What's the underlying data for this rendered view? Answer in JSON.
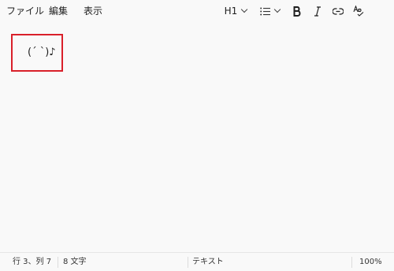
{
  "menu": {
    "file": "ファイル",
    "edit": "編集",
    "view": "表示"
  },
  "format": {
    "heading": "H1",
    "list_icon": "list-icon",
    "bold_icon": "bold-icon",
    "italic_icon": "italic-icon",
    "link_icon": "link-icon",
    "spellcheck_icon": "spellcheck-icon"
  },
  "editor": {
    "content": "(´ `)♪"
  },
  "status": {
    "position": "行 3、列 7",
    "chars": "8 文字",
    "type": "テキスト",
    "zoom": "100%"
  },
  "colors": {
    "highlight": "#d9202a",
    "background": "#f9f9f9"
  }
}
